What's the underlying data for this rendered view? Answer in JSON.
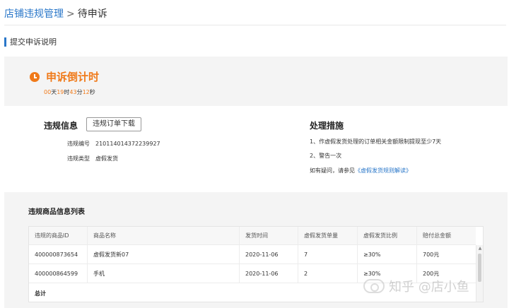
{
  "breadcrumb": {
    "parent": "店铺违规管理",
    "separator": ">",
    "current": "待申诉"
  },
  "section": {
    "label": "提交申诉说明"
  },
  "countdown": {
    "title": "申诉倒计时",
    "days": "00",
    "days_unit": "天",
    "hours": "19",
    "hours_unit": "时",
    "minutes": "43",
    "minutes_unit": "分",
    "seconds": "12",
    "seconds_unit": "秒",
    "accent_color": "#f07a1a"
  },
  "violation_info": {
    "title": "违规信息",
    "download_button": "违规订单下载",
    "number_label": "违规编号",
    "number_value": "210114014372239927",
    "type_label": "违规类型",
    "type_value": "虚假发货"
  },
  "measures": {
    "title": "处理措施",
    "item1": "1、作虚假发货处理的订单相关金额限制提现至少7天",
    "item2": "2、警告一次",
    "help_prefix": "如有疑问，请参见",
    "help_link": "《虚假发货规则解读》"
  },
  "goods_list": {
    "title": "违规商品信息列表",
    "columns": [
      "违规的商品ID",
      "商品名称",
      "发货时间",
      "虚假发货单量",
      "虚假发货比例",
      "赔付总金额"
    ],
    "rows": [
      [
        "400000873654",
        "虚假发货新07",
        "2020-11-06",
        "7",
        "≥30%",
        "700元"
      ],
      [
        "400000864599",
        "手机",
        "2020-11-06",
        "2",
        "≥30%",
        "200元"
      ]
    ],
    "total_label": "总计"
  },
  "watermark": {
    "text": "知乎 @店小鱼"
  },
  "colors": {
    "link": "#2a77c9",
    "accent": "#f07a1a",
    "panel_bg": "#f4f4f4"
  }
}
